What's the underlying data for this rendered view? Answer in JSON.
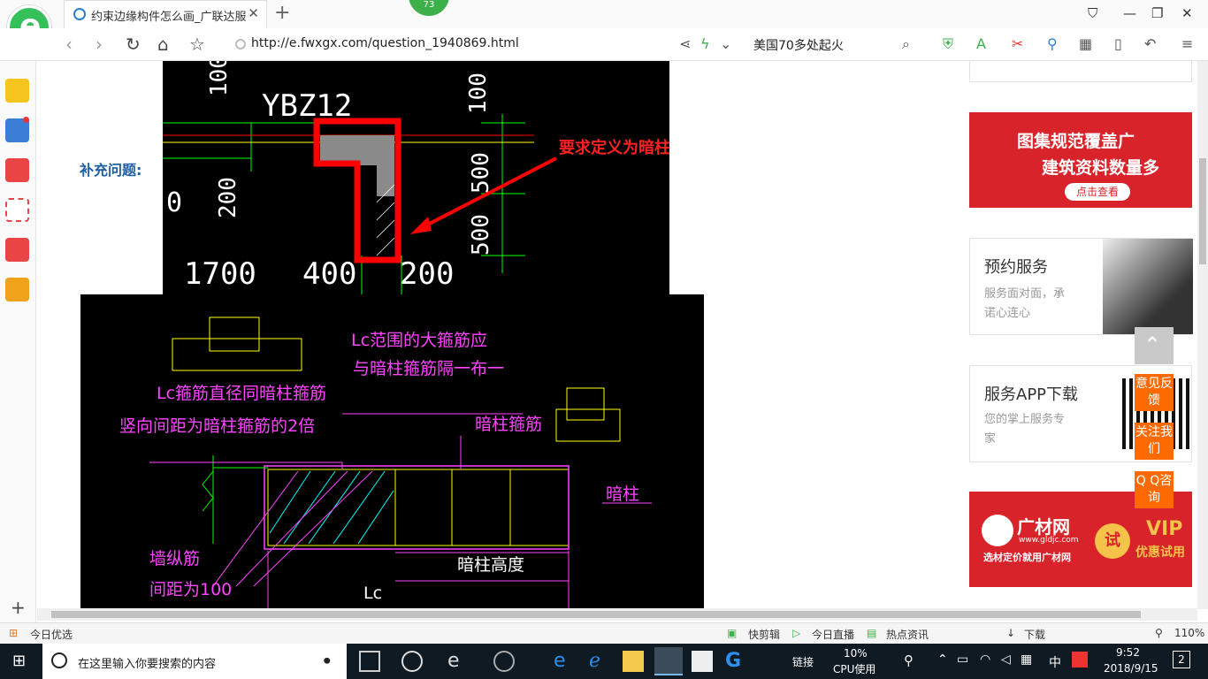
{
  "browser": {
    "tab_title": "约束边缘构件怎么画_广联达服务",
    "tab_close": "✕",
    "new_tab": "+",
    "badge": "73",
    "url": "http://e.fwxgx.com/question_1940869.html",
    "hot_search": "美国70多处起火"
  },
  "main": {
    "supplement_label": "补充问题:",
    "cad_top": {
      "title": "YBZ12",
      "annotation": "要求定义为暗柱",
      "dims": [
        "100",
        "100",
        "200",
        "500",
        "500",
        "0",
        "1700",
        "400",
        "200"
      ]
    },
    "cad_bottom": {
      "label_lc_stirrup": "Lc范围的大箍筋应",
      "label_lc_stirrup_2": "与暗柱箍筋隔一布一",
      "label_dia": "Lc箍筋直径同暗柱箍筋",
      "label_spacing": "竖向间距为暗柱箍筋的2倍",
      "label_col_stirrup": "暗柱箍筋",
      "label_col": "暗柱",
      "label_wall": "墙纵筋",
      "label_wall_2": "间距为100",
      "label_height": "暗柱高度",
      "label_lc": "Lc"
    }
  },
  "rail": {
    "banner1_line1": "图集规范覆盖广",
    "banner1_line2": "建筑资料数量多",
    "banner1_cta": "点击查看",
    "card1_title": "预约服务",
    "card1_line1": "服务面对面，承",
    "card1_line2": "诺心连心",
    "card2_title": "服务APP下载",
    "card2_line1": "您的掌上服务专",
    "card2_line2": "家",
    "banner2_brand": "广材网",
    "banner2_url": "www.gldjc.com",
    "banner2_slogan": "选材定价就用广材网",
    "banner2_try": "试",
    "banner2_vip": "VIP",
    "banner2_vip2": "优惠试用",
    "float_feedback": "意见反馈",
    "float_follow": "关注我们",
    "float_qq": "Q Q咨询"
  },
  "statusbar": {
    "left": "今日优选",
    "kuaijian": "快剪辑",
    "live": "今日直播",
    "news": "热点资讯",
    "download": "下载",
    "zoom": "110%"
  },
  "taskbar": {
    "search_placeholder": "在这里输入你要搜索的内容",
    "links": "链接",
    "cpu": "10%",
    "cpu_label": "CPU使用",
    "ime": "中",
    "time": "9:52",
    "date": "2018/9/15",
    "notifications": "2"
  },
  "colors": {
    "cad_bg": "#000000",
    "cad_red": "#ff0000",
    "cad_magenta": "#ff00ff",
    "cad_yellow": "#ffff00",
    "cad_green": "#00ff00",
    "cad_cyan": "#00ffff",
    "float_orange": "#ff6a00",
    "banner_red": "#d8232a"
  }
}
